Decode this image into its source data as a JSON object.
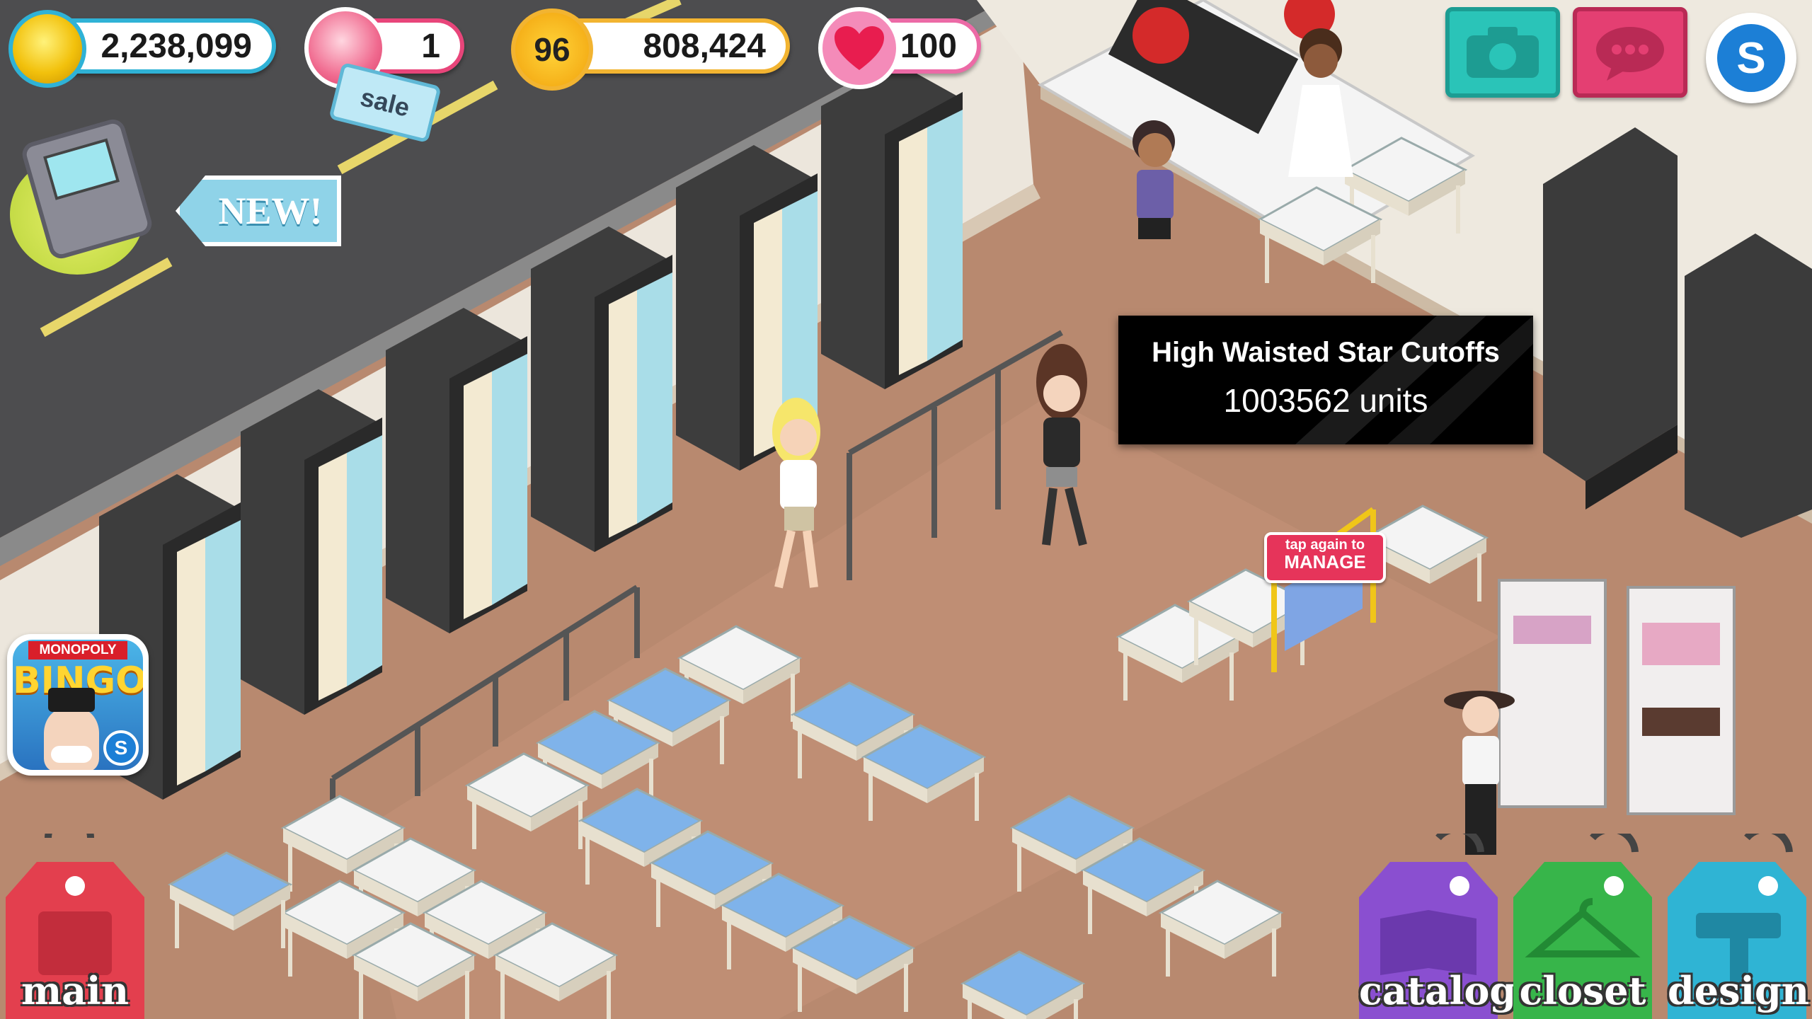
{
  "hud": {
    "coins": "2,238,099",
    "gems": "1",
    "sale_tag": "sale",
    "level": "96",
    "experience": "808,424",
    "energy": "100"
  },
  "new_tag": "NEW!",
  "top_buttons": {
    "camera": "camera-icon",
    "chat": "chat-icon",
    "currency": "S"
  },
  "tooltip": {
    "item_name": "High Waisted Star Cutoffs",
    "units": "1003562 units"
  },
  "manage_sign": {
    "line1": "tap again to",
    "line2": "MANAGE"
  },
  "promo": {
    "brand": "MONOPOLY",
    "title": "BINGO",
    "badge": "S"
  },
  "bottom_nav": {
    "main": "main",
    "catalog": "catalog",
    "closet": "closet",
    "design": "design"
  },
  "colors": {
    "coins_border": "#2fb2d6",
    "gems_border": "#e8457a",
    "xp_border": "#f2b431",
    "energy_border": "#ec6aa6",
    "camera_btn": "#2ac4b8",
    "chat_btn": "#e43f72",
    "main_tag": "#e33f4e",
    "catalog_tag": "#8a4fd0",
    "closet_tag": "#37b54a",
    "design_tag": "#2fb4d4"
  }
}
